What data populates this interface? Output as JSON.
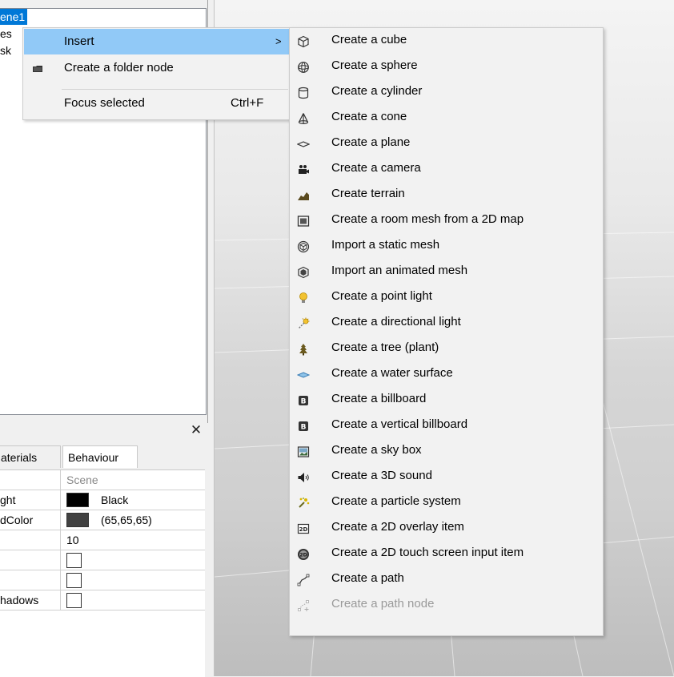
{
  "scene_tree": {
    "items": [
      {
        "label": "ene1",
        "selected": true
      },
      {
        "label": "es"
      },
      {
        "label": "sk"
      }
    ]
  },
  "context_menu": {
    "items": [
      {
        "label": "Insert",
        "has_submenu": true,
        "highlighted": true
      },
      {
        "label": "Create a folder node",
        "icon": "folder-icon"
      },
      {
        "label": "Focus selected",
        "shortcut": "Ctrl+F"
      }
    ]
  },
  "insert_submenu": {
    "items": [
      {
        "label": "Create a cube",
        "icon": "cube-icon"
      },
      {
        "label": "Create a sphere",
        "icon": "sphere-icon"
      },
      {
        "label": "Create a cylinder",
        "icon": "cylinder-icon"
      },
      {
        "label": "Create a cone",
        "icon": "cone-icon"
      },
      {
        "label": "Create a plane",
        "icon": "plane-icon"
      },
      {
        "label": "Create a camera",
        "icon": "camera-icon"
      },
      {
        "label": "Create terrain",
        "icon": "terrain-icon"
      },
      {
        "label": "Create a room mesh from a 2D map",
        "icon": "room-mesh-icon"
      },
      {
        "label": "Import a static mesh",
        "icon": "static-mesh-icon"
      },
      {
        "label": "Import an animated mesh",
        "icon": "animated-mesh-icon"
      },
      {
        "label": "Create a point light",
        "icon": "light-bulb-icon"
      },
      {
        "label": "Create a directional light",
        "icon": "directional-light-icon"
      },
      {
        "label": "Create a tree (plant)",
        "icon": "tree-icon"
      },
      {
        "label": "Create a water surface",
        "icon": "water-surface-icon"
      },
      {
        "label": "Create a billboard",
        "icon": "billboard-icon"
      },
      {
        "label": "Create a vertical billboard",
        "icon": "vertical-billboard-icon"
      },
      {
        "label": "Create a sky box",
        "icon": "sky-box-icon"
      },
      {
        "label": "Create a 3D sound",
        "icon": "speaker-icon"
      },
      {
        "label": "Create a particle system",
        "icon": "particle-system-icon"
      },
      {
        "label": "Create a 2D overlay item",
        "icon": "overlay-2d-icon"
      },
      {
        "label": "Create a 2D touch screen input item",
        "icon": "touch-input-2d-icon"
      },
      {
        "label": "Create a path",
        "icon": "path-icon"
      },
      {
        "label": "Create a path node",
        "icon": "path-node-icon",
        "disabled": true
      }
    ]
  },
  "properties_panel": {
    "close_glyph": "✕",
    "tabs": [
      {
        "label": "aterials"
      },
      {
        "label": "Behaviour",
        "active": true
      }
    ],
    "rows": [
      {
        "name": "",
        "value": "Scene",
        "muted": true
      },
      {
        "name": "ght",
        "value": "Black",
        "swatch": "#000000"
      },
      {
        "name": "dColor",
        "value": "(65,65,65)",
        "swatch": "#414141"
      },
      {
        "name": "",
        "value": "10"
      },
      {
        "name": "",
        "value": "",
        "checkbox": false
      },
      {
        "name": "",
        "value": "",
        "checkbox": false
      },
      {
        "name": "hadows",
        "value": "",
        "checkbox": false
      }
    ]
  },
  "colors": {
    "selection": "#0078d7",
    "menu_highlight": "#91c9f7",
    "menu_background": "#f2f2f2"
  }
}
